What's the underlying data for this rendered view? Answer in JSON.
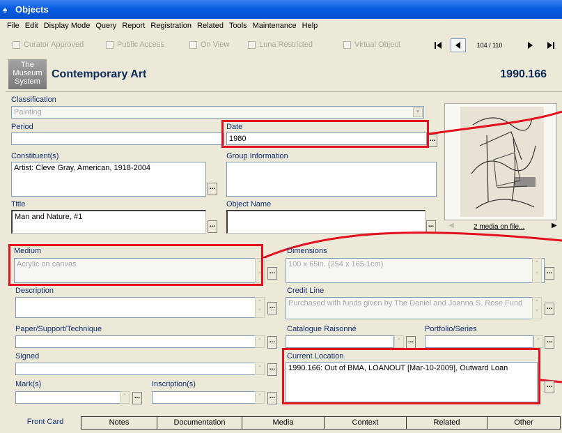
{
  "window": {
    "title": "Objects"
  },
  "menu": [
    "File",
    "Edit",
    "Display Mode",
    "Query",
    "Report",
    "Registration",
    "Related",
    "Tools",
    "Maintenance",
    "Help"
  ],
  "flags": [
    "Curator Approved",
    "Public Access",
    "On View",
    "Luna Restricted",
    "Virtual Object"
  ],
  "nav": {
    "counter": "104 / 110"
  },
  "header": {
    "logo_lines": [
      "The",
      "Museum",
      "System"
    ],
    "department": "Contemporary Art",
    "object_number": "1990.166"
  },
  "fields": {
    "classification": {
      "label": "Classification",
      "value": "Painting"
    },
    "period": {
      "label": "Period",
      "value": ""
    },
    "date": {
      "label": "Date",
      "value": "1980"
    },
    "constituents": {
      "label": "Constituent(s)",
      "value": "Artist: Cleve Gray, American, 1918-2004"
    },
    "group_information": {
      "label": "Group Information",
      "value": ""
    },
    "title": {
      "label": "Title",
      "value": "Man and Nature, #1"
    },
    "object_name": {
      "label": "Object Name",
      "value": ""
    },
    "medium": {
      "label": "Medium",
      "value": "Acrylic on canvas"
    },
    "dimensions": {
      "label": "Dimensions",
      "value": "100 x 65in. (254 x 165.1cm)"
    },
    "description": {
      "label": "Description",
      "value": ""
    },
    "credit_line": {
      "label": "Credit Line",
      "value": "Purchased with funds given by The Daniel and Joanna S. Rose Fund"
    },
    "paper_support": {
      "label": "Paper/Support/Technique",
      "value": ""
    },
    "catalogue_raisonne": {
      "label": "Catalogue Raisonné",
      "value": ""
    },
    "portfolio_series": {
      "label": "Portfolio/Series",
      "value": ""
    },
    "signed": {
      "label": "Signed",
      "value": ""
    },
    "current_location": {
      "label": "Current Location",
      "value": "1990.166: Out of BMA, LOANOUT [Mar-10-2009], Outward Loan"
    },
    "marks": {
      "label": "Mark(s)",
      "value": ""
    },
    "inscriptions": {
      "label": "Inscription(s)",
      "value": ""
    }
  },
  "media": {
    "caption": "2 media on file..."
  },
  "tabs": [
    "Front Card",
    "Notes",
    "Documentation",
    "Media",
    "Context",
    "Related",
    "Other"
  ],
  "colors": {
    "highlight": "#e4101e",
    "label": "#0f2f75",
    "title_bar": "#0a5ce0"
  }
}
